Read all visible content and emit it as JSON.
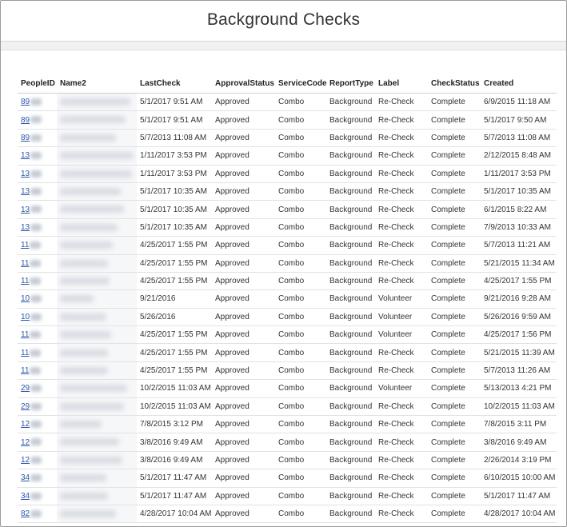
{
  "page": {
    "title": "Background Checks"
  },
  "table": {
    "headers": [
      "PeopleID",
      "Name2",
      "LastCheck",
      "ApprovalStatus",
      "ServiceCode",
      "ReportType",
      "Label",
      "CheckStatus",
      "Created"
    ],
    "rows": [
      {
        "pid": "89",
        "last": "5/1/2017 9:51 AM",
        "approval": "Approved",
        "service": "Combo",
        "report": "Background",
        "label": "Re-Check",
        "status": "Complete",
        "created": "6/9/2015 11:18 AM"
      },
      {
        "pid": "89",
        "last": "5/1/2017 9:51 AM",
        "approval": "Approved",
        "service": "Combo",
        "report": "Background",
        "label": "Re-Check",
        "status": "Complete",
        "created": "5/1/2017 9:50 AM"
      },
      {
        "pid": "89",
        "last": "5/7/2013 11:08 AM",
        "approval": "Approved",
        "service": "Combo",
        "report": "Background",
        "label": "Re-Check",
        "status": "Complete",
        "created": "5/7/2013 11:08 AM"
      },
      {
        "pid": "13",
        "last": "1/11/2017 3:53 PM",
        "approval": "Approved",
        "service": "Combo",
        "report": "Background",
        "label": "Re-Check",
        "status": "Complete",
        "created": "2/12/2015 8:48 AM"
      },
      {
        "pid": "13",
        "last": "1/11/2017 3:53 PM",
        "approval": "Approved",
        "service": "Combo",
        "report": "Background",
        "label": "Re-Check",
        "status": "Complete",
        "created": "1/11/2017 3:53 PM"
      },
      {
        "pid": "13",
        "last": "5/1/2017 10:35 AM",
        "approval": "Approved",
        "service": "Combo",
        "report": "Background",
        "label": "Re-Check",
        "status": "Complete",
        "created": "5/1/2017 10:35 AM"
      },
      {
        "pid": "13",
        "last": "5/1/2017 10:35 AM",
        "approval": "Approved",
        "service": "Combo",
        "report": "Background",
        "label": "Re-Check",
        "status": "Complete",
        "created": "6/1/2015 8:22 AM"
      },
      {
        "pid": "13",
        "last": "5/1/2017 10:35 AM",
        "approval": "Approved",
        "service": "Combo",
        "report": "Background",
        "label": "Re-Check",
        "status": "Complete",
        "created": "7/9/2013 10:33 AM"
      },
      {
        "pid": "11",
        "last": "4/25/2017 1:55 PM",
        "approval": "Approved",
        "service": "Combo",
        "report": "Background",
        "label": "Re-Check",
        "status": "Complete",
        "created": "5/7/2013 11:21 AM"
      },
      {
        "pid": "11",
        "last": "4/25/2017 1:55 PM",
        "approval": "Approved",
        "service": "Combo",
        "report": "Background",
        "label": "Re-Check",
        "status": "Complete",
        "created": "5/21/2015 11:34 AM"
      },
      {
        "pid": "11",
        "last": "4/25/2017 1:55 PM",
        "approval": "Approved",
        "service": "Combo",
        "report": "Background",
        "label": "Re-Check",
        "status": "Complete",
        "created": "4/25/2017 1:55 PM"
      },
      {
        "pid": "10",
        "last": "9/21/2016",
        "approval": "Approved",
        "service": "Combo",
        "report": "Background",
        "label": "Volunteer",
        "status": "Complete",
        "created": "9/21/2016 9:28 AM"
      },
      {
        "pid": "10",
        "last": "5/26/2016",
        "approval": "Approved",
        "service": "Combo",
        "report": "Background",
        "label": "Volunteer",
        "status": "Complete",
        "created": "5/26/2016 9:59 AM"
      },
      {
        "pid": "11",
        "last": "4/25/2017 1:55 PM",
        "approval": "Approved",
        "service": "Combo",
        "report": "Background",
        "label": "Volunteer",
        "status": "Complete",
        "created": "4/25/2017 1:56 PM"
      },
      {
        "pid": "11",
        "last": "4/25/2017 1:55 PM",
        "approval": "Approved",
        "service": "Combo",
        "report": "Background",
        "label": "Re-Check",
        "status": "Complete",
        "created": "5/21/2015 11:39 AM"
      },
      {
        "pid": "11",
        "last": "4/25/2017 1:55 PM",
        "approval": "Approved",
        "service": "Combo",
        "report": "Background",
        "label": "Re-Check",
        "status": "Complete",
        "created": "5/7/2013 11:26 AM"
      },
      {
        "pid": "29",
        "last": "10/2/2015 11:03 AM",
        "approval": "Approved",
        "service": "Combo",
        "report": "Background",
        "label": "Volunteer",
        "status": "Complete",
        "created": "5/13/2013 4:21 PM"
      },
      {
        "pid": "29",
        "last": "10/2/2015 11:03 AM",
        "approval": "Approved",
        "service": "Combo",
        "report": "Background",
        "label": "Re-Check",
        "status": "Complete",
        "created": "10/2/2015 11:03 AM"
      },
      {
        "pid": "12",
        "last": "7/8/2015 3:12 PM",
        "approval": "Approved",
        "service": "Combo",
        "report": "Background",
        "label": "Re-Check",
        "status": "Complete",
        "created": "7/8/2015 3:11 PM"
      },
      {
        "pid": "12",
        "last": "3/8/2016 9:49 AM",
        "approval": "Approved",
        "service": "Combo",
        "report": "Background",
        "label": "Re-Check",
        "status": "Complete",
        "created": "3/8/2016 9:49 AM"
      },
      {
        "pid": "12",
        "last": "3/8/2016 9:49 AM",
        "approval": "Approved",
        "service": "Combo",
        "report": "Background",
        "label": "Re-Check",
        "status": "Complete",
        "created": "2/26/2014 3:19 PM"
      },
      {
        "pid": "34",
        "last": "5/1/2017 11:47 AM",
        "approval": "Approved",
        "service": "Combo",
        "report": "Background",
        "label": "Re-Check",
        "status": "Complete",
        "created": "6/10/2015 10:00 AM"
      },
      {
        "pid": "34",
        "last": "5/1/2017 11:47 AM",
        "approval": "Approved",
        "service": "Combo",
        "report": "Background",
        "label": "Re-Check",
        "status": "Complete",
        "created": "5/1/2017 11:47 AM"
      },
      {
        "pid": "82",
        "last": "4/28/2017 10:04 AM",
        "approval": "Approved",
        "service": "Combo",
        "report": "Background",
        "label": "Re-Check",
        "status": "Complete",
        "created": "4/28/2017 10:04 AM"
      }
    ]
  },
  "colors": {
    "link": "#2a55a8",
    "border": "#9a9a9a"
  }
}
